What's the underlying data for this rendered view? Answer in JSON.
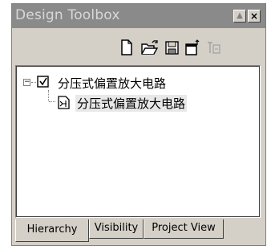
{
  "window": {
    "title": "Design Toolbox",
    "maximize_glyph": "▲",
    "close_glyph": "×"
  },
  "toolbar": {
    "icons": [
      "new-document-icon",
      "open-folder-icon",
      "save-icon",
      "export-icon",
      "text-icon"
    ]
  },
  "tree": {
    "expander_glyph": "−",
    "root": {
      "label": "分压式偏置放大电路",
      "icon": "design-checkbox-icon"
    },
    "child": {
      "label": "分压式偏置放大电路",
      "icon": "schematic-sheet-icon"
    }
  },
  "tabs": [
    {
      "label": "Hierarchy",
      "active": true
    },
    {
      "label": "Visibility",
      "active": false
    },
    {
      "label": "Project View",
      "active": false
    }
  ]
}
